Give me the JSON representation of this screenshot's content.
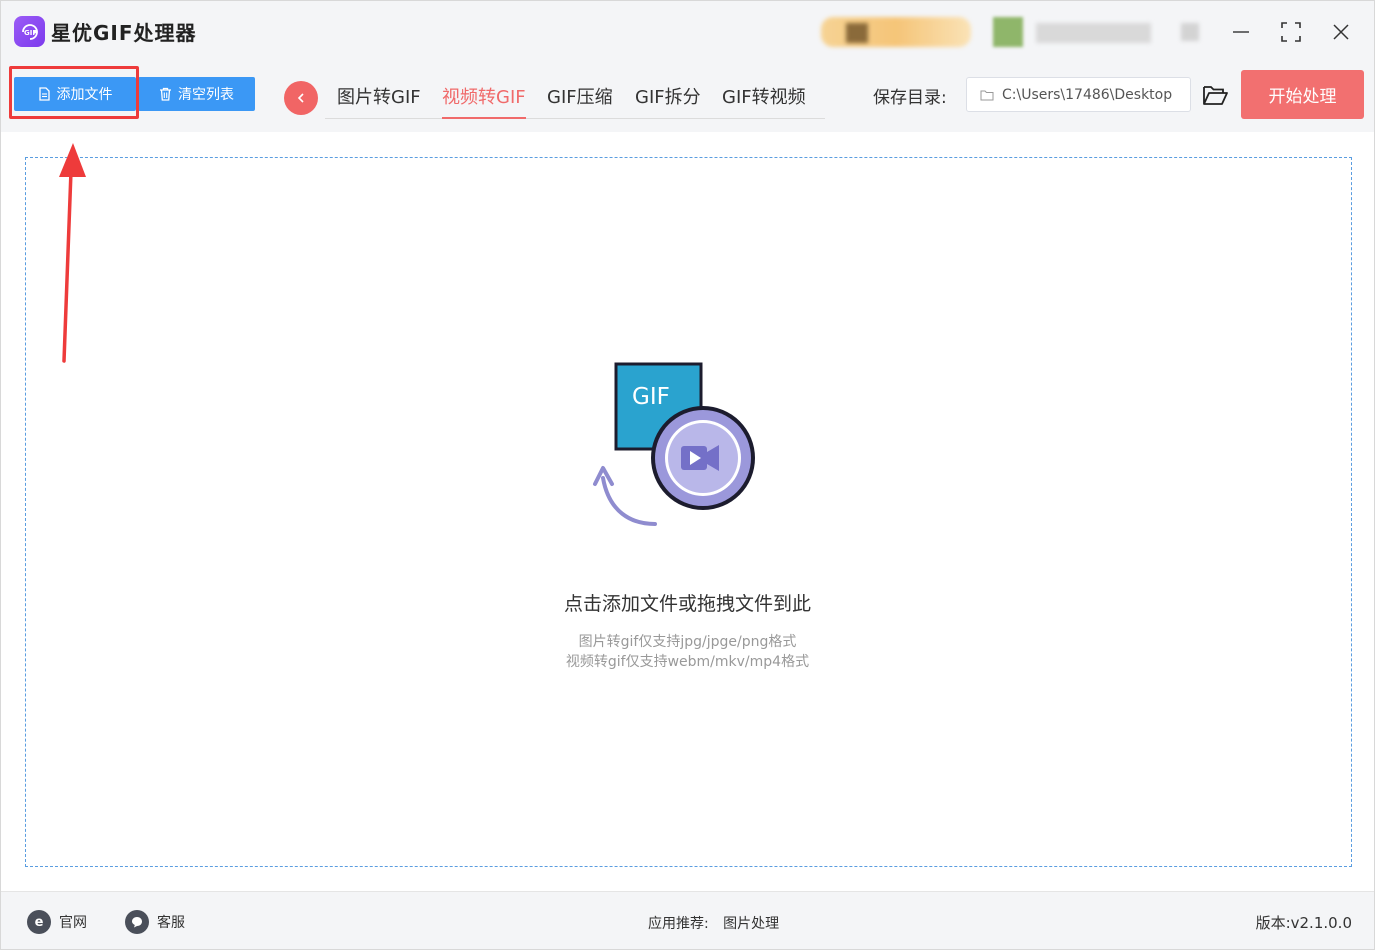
{
  "titlebar": {
    "app_title": "星优GIF处理器",
    "logo_text": "GIF"
  },
  "toolbar": {
    "add_file_label": "添加文件",
    "clear_list_label": "清空列表",
    "tabs": [
      {
        "label": "图片转GIF",
        "active": false
      },
      {
        "label": "视频转GIF",
        "active": true
      },
      {
        "label": "GIF压缩",
        "active": false
      },
      {
        "label": "GIF拆分",
        "active": false
      },
      {
        "label": "GIF转视频",
        "active": false
      }
    ],
    "save_dir_label": "保存目录:",
    "save_dir_value": "C:\\Users\\17486\\Desktop",
    "start_label": "开始处理"
  },
  "dropzone": {
    "illustration_text": "GIF",
    "main_text": "点击添加文件或拖拽文件到此",
    "hint_image": "图片转gif仅支持jpg/jpge/png格式",
    "hint_video": "视频转gif仅支持webm/mkv/mp4格式"
  },
  "footer": {
    "website_label": "官网",
    "support_label": "客服",
    "recommend_label": "应用推荐:",
    "recommend_link": "图片处理",
    "version_text": "版本:v2.1.0.0"
  },
  "colors": {
    "accent_blue": "#3b98f5",
    "accent_red": "#f27070",
    "active_tab": "#f06a6a",
    "annotation": "#ee3b3b"
  }
}
